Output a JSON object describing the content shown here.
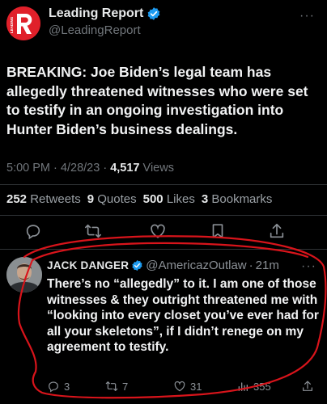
{
  "main_tweet": {
    "avatar_text": "LEADING",
    "display_name": "Leading Report",
    "handle": "@LeadingReport",
    "text_lead": "BREAKING:",
    "text_body": " Joe Biden’s legal team has allegedly threatened witnesses who were set to testify in an ongoing investigation into Hunter Biden’s business dealings.",
    "time": "5:00 PM",
    "date": "4/28/23",
    "views_count": "4,517",
    "views_label": "Views",
    "separator": "·"
  },
  "stats": {
    "retweets_count": "252",
    "retweets_label": "Retweets",
    "quotes_count": "9",
    "quotes_label": "Quotes",
    "likes_count": "500",
    "likes_label": "Likes",
    "bookmarks_count": "3",
    "bookmarks_label": "Bookmarks"
  },
  "reply": {
    "display_name": "JACK DANGER",
    "handle": "@AmericazOutlaw",
    "time": "21m",
    "separator": "·",
    "text": "There’s no “allegedly” to it. I am one of those witnesses & they outright threatened me with “looking into every closet you’ve ever had for all your skeletons”, if I didn’t renege on my agreement to testify.",
    "replies": "3",
    "retweets": "7",
    "likes": "31",
    "views": "355"
  },
  "more_icon_glyph": "···",
  "colors": {
    "verified": "#1d9bf0",
    "annotation": "#d8141b",
    "brand": "#e0202a"
  }
}
